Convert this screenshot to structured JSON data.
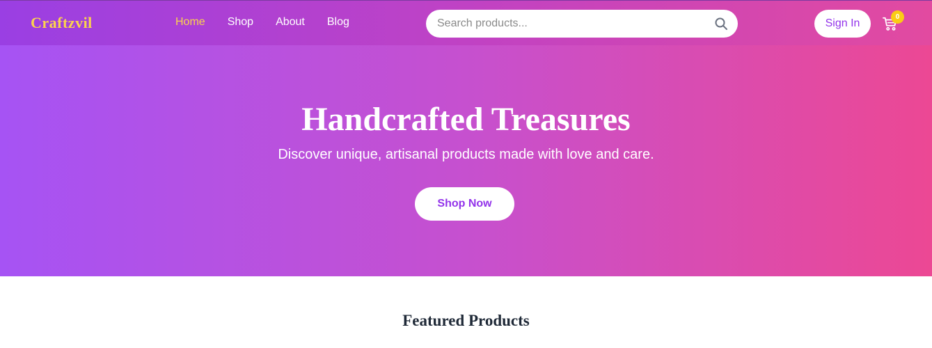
{
  "header": {
    "logo": "Craftzvil",
    "nav": [
      {
        "label": "Home",
        "active": true
      },
      {
        "label": "Shop",
        "active": false
      },
      {
        "label": "About",
        "active": false
      },
      {
        "label": "Blog",
        "active": false
      }
    ],
    "search": {
      "placeholder": "Search products...",
      "value": "",
      "icon": "search-icon"
    },
    "sign_in_label": "Sign In",
    "cart": {
      "icon": "cart-icon",
      "count": "0"
    }
  },
  "hero": {
    "title": "Handcrafted Treasures",
    "subtitle": "Discover unique, artisanal products made with love and care.",
    "cta_label": "Shop Now"
  },
  "featured": {
    "title": "Featured Products"
  },
  "colors": {
    "accent": "#fcd34d",
    "primary": "#9333ea",
    "gradient_start": "#a653f4",
    "gradient_end": "#ec4894",
    "badge": "#facc15"
  }
}
